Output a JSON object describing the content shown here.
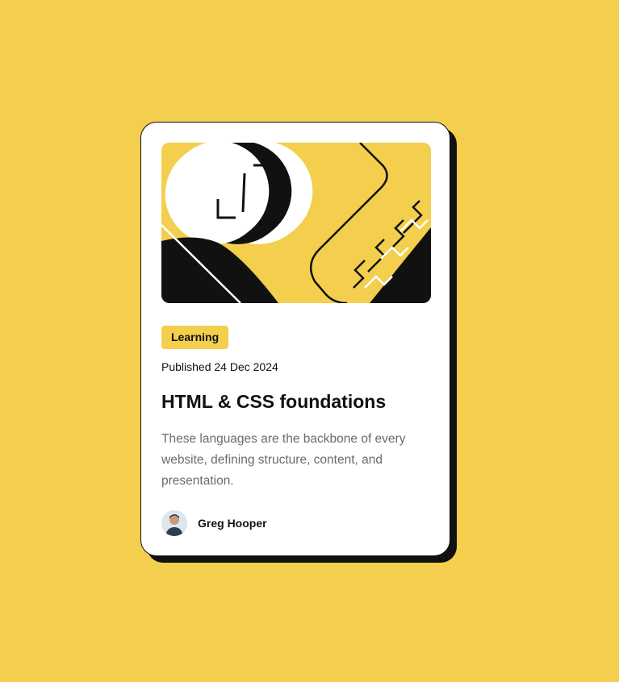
{
  "card": {
    "hero_alt": "illustration-article",
    "tag": "Learning",
    "published": "Published 24 Dec 2024",
    "title": "HTML & CSS foundations",
    "description": "These languages are the backbone of every website, defining structure, content, and presentation.",
    "author": {
      "name": "Greg Hooper",
      "avatar_icon": "user-avatar"
    }
  },
  "colors": {
    "background": "#F4CE4D",
    "card": "#FFFFFF",
    "ink": "#111111",
    "muted_text": "#6B6B6B",
    "tag_background": "#F4CE4D"
  }
}
